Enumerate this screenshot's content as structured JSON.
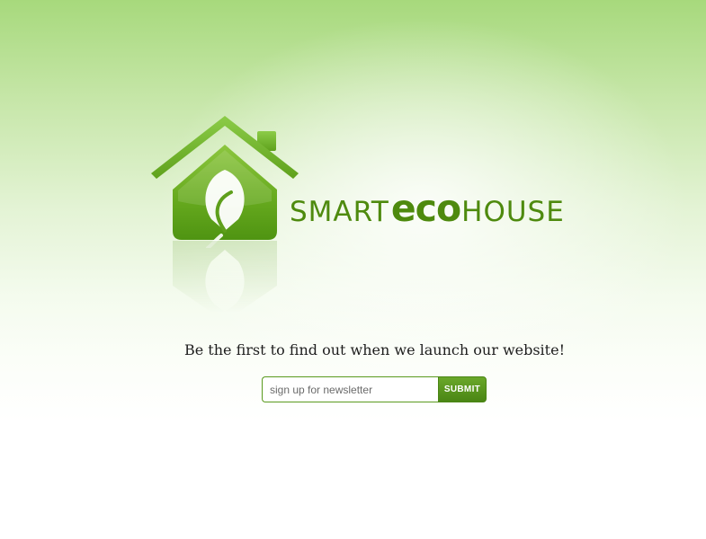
{
  "logo": {
    "icon": "house-leaf-icon",
    "brand_part1": "SMART",
    "brand_part2": "eco",
    "brand_part3": "HOUSE",
    "color": "#4e8a0e"
  },
  "tagline": "Be the first to find out when we launch our website!",
  "newsletter": {
    "placeholder": "sign up for newsletter",
    "value": "",
    "submit_label": "SUBMIT",
    "accent_color": "#4a8514"
  },
  "background": {
    "top_color": "#a7d97c",
    "bottom_color": "#ffffff"
  }
}
